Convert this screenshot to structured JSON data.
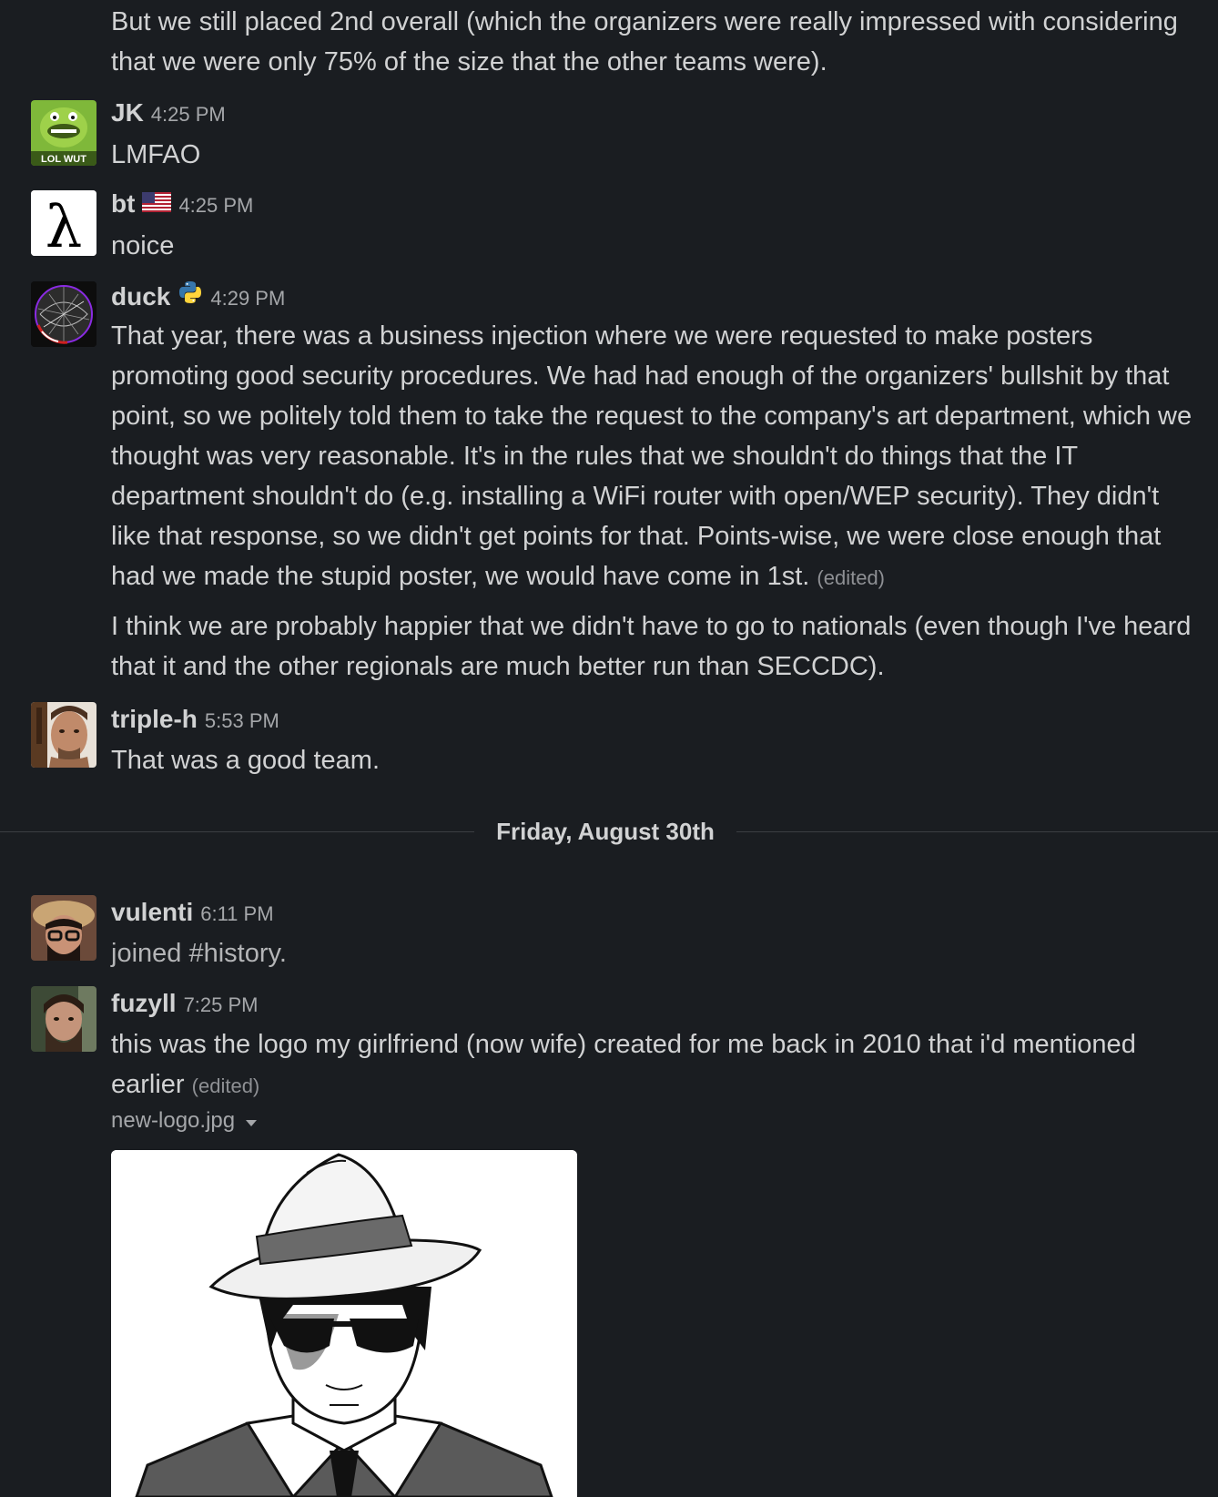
{
  "messages": [
    {
      "id": "cont-top",
      "text": "But we still placed 2nd overall (which the organizers were really impressed with considering that we were only 75% of the size that the other teams were)."
    },
    {
      "id": "jk",
      "username": "JK",
      "time": "4:25 PM",
      "text": "LMFAO",
      "avatar_caption": "LOL WUT"
    },
    {
      "id": "bt",
      "username": "bt",
      "time": "4:25 PM",
      "text": "noice",
      "avatar_glyph": "λ",
      "status_icon": "us-flag-icon"
    },
    {
      "id": "duck",
      "username": "duck",
      "time": "4:29 PM",
      "status_icon": "python-icon",
      "text": "That year, there was a business injection where we were requested to make posters promoting good security procedures. We had had enough of the organizers' bullshit by that point, so we politely told them to take the request to the company's art department, which we thought was very reasonable. It's in the rules that we shouldn't do things that the IT department shouldn't do (e.g. installing a WiFi router with open/WEP security). They didn't like that response, so we didn't get points for that. Points-wise, we were close enough that had we made the stupid poster, we would have come in 1st.",
      "edited": "(edited)",
      "text2": "I think we are probably happier that we didn't have to go to nationals (even though I've heard that it and the other regionals are much better run than SECCDC)."
    },
    {
      "id": "triple-h",
      "username": "triple-h",
      "time": "5:53 PM",
      "text": "That was a good team."
    },
    {
      "id": "vulenti",
      "username": "vulenti",
      "time": "6:11 PM",
      "text": "joined #history."
    },
    {
      "id": "fuzyll",
      "username": "fuzyll",
      "time": "7:25 PM",
      "text": "this was the logo my girlfriend (now wife) created for me back in 2010 that i'd mentioned earlier",
      "edited": "(edited)",
      "file_name": "new-logo.jpg"
    }
  ],
  "date_divider": "Friday, August 30th",
  "colors": {
    "background": "#1a1d21",
    "text": "#d1d2d3",
    "muted": "#a5a7aa"
  }
}
